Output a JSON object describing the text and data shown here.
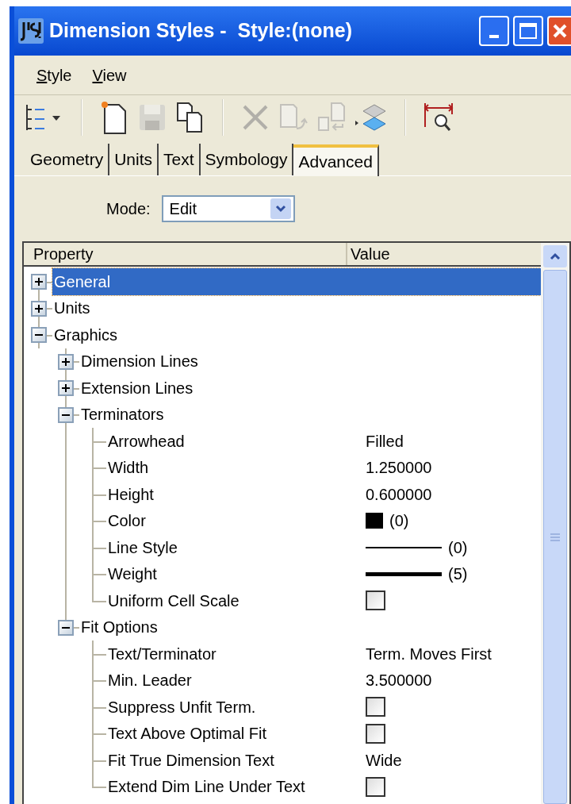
{
  "window": {
    "title": "Dimension Styles -  Style:(none)"
  },
  "menu": [
    {
      "label": "Style"
    },
    {
      "label": "View"
    }
  ],
  "toolbar": [
    [
      {
        "kind": "tree-view",
        "disabled": false
      }
    ],
    [
      {
        "kind": "new",
        "disabled": false
      },
      {
        "kind": "save",
        "disabled": true
      },
      {
        "kind": "copy",
        "disabled": false
      }
    ],
    [
      {
        "kind": "delete",
        "disabled": true
      },
      {
        "kind": "import",
        "disabled": true
      },
      {
        "kind": "export",
        "disabled": true
      },
      {
        "kind": "layers",
        "disabled": false
      }
    ],
    [
      {
        "kind": "dimension-zoom",
        "disabled": false
      }
    ]
  ],
  "tabs": [
    {
      "label": "Geometry",
      "selected": false
    },
    {
      "label": "Units",
      "selected": false
    },
    {
      "label": "Text",
      "selected": false
    },
    {
      "label": "Symbology",
      "selected": false
    },
    {
      "label": "Advanced",
      "selected": true
    }
  ],
  "mode": {
    "label": "Mode:",
    "value": "Edit"
  },
  "table": {
    "columns": [
      "Property",
      "Value"
    ],
    "tree": [
      {
        "label": "General",
        "expanded": false,
        "selected": true
      },
      {
        "label": "Units",
        "expanded": false,
        "selected": false
      },
      {
        "label": "Graphics",
        "expanded": true,
        "selected": false,
        "children": [
          {
            "label": "Dimension Lines",
            "expanded": false,
            "selected": false
          },
          {
            "label": "Extension Lines",
            "expanded": false,
            "selected": false
          },
          {
            "label": "Terminators",
            "expanded": true,
            "selected": false,
            "children": [
              {
                "label": "Arrowhead",
                "selected": false,
                "value": {
                  "kind": "text",
                  "text": "Filled"
                }
              },
              {
                "label": "Width",
                "selected": false,
                "value": {
                  "kind": "text",
                  "text": "1.250000"
                }
              },
              {
                "label": "Height",
                "selected": false,
                "value": {
                  "kind": "text",
                  "text": "0.600000"
                }
              },
              {
                "label": "Color",
                "selected": false,
                "value": {
                  "kind": "color",
                  "color": "#000000",
                  "text": "(0)"
                }
              },
              {
                "label": "Line Style",
                "selected": false,
                "value": {
                  "kind": "line-style",
                  "text": "(0)"
                }
              },
              {
                "label": "Weight",
                "selected": false,
                "value": {
                  "kind": "line-weight",
                  "text": "(5)"
                }
              },
              {
                "label": "Uniform Cell Scale",
                "selected": false,
                "value": {
                  "kind": "checkbox",
                  "checked": false
                }
              }
            ]
          },
          {
            "label": "Fit Options",
            "expanded": true,
            "selected": false,
            "children": [
              {
                "label": "Text/Terminator",
                "selected": false,
                "value": {
                  "kind": "text",
                  "text": "Term. Moves First"
                }
              },
              {
                "label": "Min. Leader",
                "selected": false,
                "value": {
                  "kind": "text",
                  "text": "3.500000"
                }
              },
              {
                "label": "Suppress Unfit Term.",
                "selected": false,
                "value": {
                  "kind": "checkbox",
                  "checked": false
                }
              },
              {
                "label": "Text Above Optimal Fit",
                "selected": false,
                "value": {
                  "kind": "checkbox",
                  "checked": false
                }
              },
              {
                "label": "Fit True Dimension Text",
                "selected": false,
                "value": {
                  "kind": "text",
                  "text": "Wide"
                }
              },
              {
                "label": "Extend Dim Line Under Text",
                "selected": false,
                "value": {
                  "kind": "checkbox",
                  "checked": false
                }
              }
            ]
          }
        ]
      }
    ]
  }
}
